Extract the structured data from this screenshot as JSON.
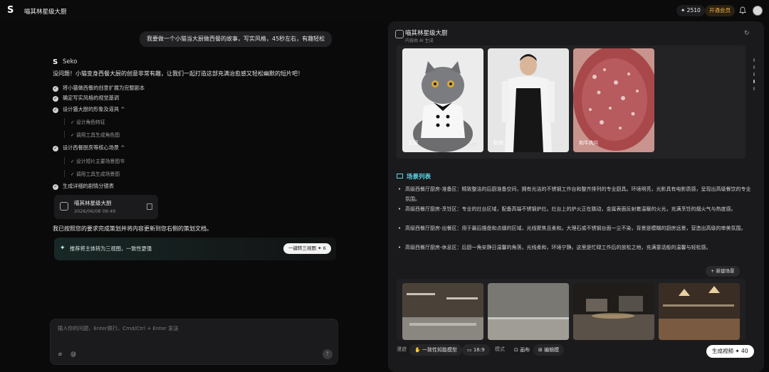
{
  "topbar": {
    "title": "喵其林星级大厨",
    "credits": "✦ 2510",
    "member_label": "开通会员",
    "icons": {
      "logo": "seko-logo-icon",
      "bell": "bell-icon",
      "avatar": "avatar"
    }
  },
  "chat": {
    "user_message": "我要做一个小猫当大厨做西餐的故事，写实风格，45秒左右，有趣轻松",
    "assistant_name": "Seko",
    "intro": "没问题！小猫变身西餐大厨的创意非常有趣，让我们一起打造这部充满治愈感又轻松幽默的短片吧！",
    "steps": [
      {
        "label": "将小猫做西餐的创意扩展为完整剧本"
      },
      {
        "label": "确定写实风格的视觉基调"
      },
      {
        "label": "设计猫大厨的形象及道具",
        "chevron": "^",
        "subs": [
          "设计角色特征",
          "调用工具生成角色图"
        ]
      },
      {
        "label": "设计西餐厨房等核心场景",
        "chevron": "^",
        "subs": [
          "设计短片主要场景图书",
          "调用工具生成场景图"
        ]
      },
      {
        "label": "生成详细的剧情分镜表"
      }
    ],
    "doc_card": {
      "title": "喵其林星级大厨",
      "date": "2026/06/08 09:49"
    },
    "done_text": "我已按照您的要求完成策划并将内容更新到您右侧的策划文档。",
    "promo": {
      "text": "推荐将主体转为三视图，一致性更强",
      "button": "一键转三视图 ✦ 6"
    },
    "composer": {
      "placeholder": "输入你的问题，Enter换行，Cmd/Ctrl + Enter 发送"
    }
  },
  "panel": {
    "title": "喵其林星级大厨",
    "subtitle": "内容由 AI 生成",
    "characters": [
      {
        "label": "主厨"
      },
      {
        "label": "助理"
      },
      {
        "label": "和牛肉片"
      }
    ],
    "scene_section_title": "场景列表",
    "scenes": [
      "高级西餐厅厨房-准备区：精致整洁的后厨准备空间，拥有光洁的不锈钢工作台和整齐排列的专业厨具。环境明亮，光影具有电影质感，呈现出高级餐饮的专业氛围。",
      "高级西餐厅厨房-烹饪区：专业的灶台区域，配备高端不锈钢炉灶。灶台上的炉火正在跳动，金属表面反射着温暖的火光，充满烹饪的烟火气与热度感。",
      "高级西餐厅厨房-出餐区：用于最后摆盘和点缀的区域，光线聚焦且柔和。大理石或不锈钢台面一尘不染，背景是模糊的厨房远景，营造出高级的审美氛围。",
      "高级西餐厅厨房-休息区：后厨一角安静日温馨的角落，光线柔和，环境宁静。这里是忙碌工作后的放松之地，充满童话般的温馨与轻松感。"
    ],
    "new_scene_button": "+ 新建场景",
    "toolbar": {
      "mode_label": "漫遊",
      "model": "一致性知能模型",
      "ratio": "16:9",
      "style_label": "模式",
      "board": "画布",
      "edit": "编辑模",
      "generate": "生成视频 ✦ 40"
    }
  },
  "colors": {
    "accent": "#5ad4e6",
    "member": "#f0b34a",
    "bg": "#0a0a0b",
    "panel": "#1a1a1c"
  }
}
